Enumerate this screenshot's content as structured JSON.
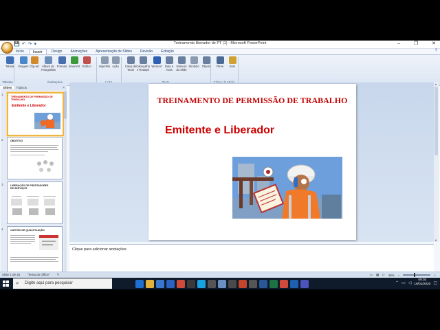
{
  "window": {
    "title": "Treinamento liberador de PT (1) - Microsoft PowerPoint",
    "controls": [
      "–",
      "❐",
      "✕"
    ],
    "quick_access": [
      "💾",
      "↶",
      "↷",
      "▾"
    ],
    "help": "?"
  },
  "ribbon": {
    "tabs": [
      "Início",
      "Inserir",
      "Design",
      "Animações",
      "Apresentação de Slides",
      "Revisão",
      "Exibição"
    ],
    "active_tab": "Inserir",
    "buttons": [
      {
        "label": "Tabela",
        "icon": "table-icon",
        "color": "#3f6fb6"
      },
      {
        "label": "Imagem",
        "icon": "picture-icon",
        "color": "#4a87c8"
      },
      {
        "label": "Clip-art",
        "icon": "clipart-icon",
        "color": "#d08a2a"
      },
      {
        "label": "Álbum de Fotografias",
        "icon": "album-icon",
        "color": "#6b8fb8"
      },
      {
        "label": "Formas",
        "icon": "shapes-icon",
        "color": "#4a6fb0"
      },
      {
        "label": "SmartArt",
        "icon": "smartart-icon",
        "color": "#3c9a3c"
      },
      {
        "label": "Gráfico",
        "icon": "chart-icon",
        "color": "#c0504d"
      },
      {
        "label": "Hiperlink",
        "icon": "hyperlink-icon",
        "color": "#8b9bb0"
      },
      {
        "label": "Ação",
        "icon": "action-icon",
        "color": "#8b9bb0"
      },
      {
        "label": "Caixa de Texto",
        "icon": "textbox-icon",
        "color": "#6a7f9f"
      },
      {
        "label": "Cabeçalho e Rodapé",
        "icon": "header-footer-icon",
        "color": "#6a7f9f"
      },
      {
        "label": "WordArt",
        "icon": "wordart-icon",
        "color": "#2e5fb0"
      },
      {
        "label": "Data e Hora",
        "icon": "datetime-icon",
        "color": "#6a7f9f"
      },
      {
        "label": "Número do Slide",
        "icon": "slide-number-icon",
        "color": "#6a7f9f"
      },
      {
        "label": "Símbolo",
        "icon": "symbol-icon",
        "color": "#8b9bb0"
      },
      {
        "label": "Objeto",
        "icon": "object-icon",
        "color": "#6a7f9f"
      },
      {
        "label": "Filme",
        "icon": "movie-icon",
        "color": "#4a6a96"
      },
      {
        "label": "Som",
        "icon": "sound-icon",
        "color": "#d0a030"
      }
    ],
    "groups": [
      "Tabelas",
      "Ilustrações",
      "Links",
      "Texto",
      "Clipes de Mídia"
    ]
  },
  "slide_panel": {
    "tabs": [
      "Slides",
      "Tópicos"
    ],
    "active_tab": "Slides",
    "thumbnails": [
      {
        "number": "1",
        "title": "TREINAMENTO DE PERMISSÃO DE TRABALHO",
        "subtitle": "Emitente e Liberador",
        "selected": true
      },
      {
        "number": "2",
        "title": "OBJETIVO",
        "selected": false
      },
      {
        "number": "3",
        "title": "LIBERAÇÃO DE PRESTADORES DE SERVIÇOS",
        "selected": false
      },
      {
        "number": "4",
        "title": "CARTÃO DE QUALIFICAÇÃO",
        "selected": false
      }
    ]
  },
  "slide": {
    "title": "TREINAMENTO DE PERMISSÃO DE TRABALHO",
    "subtitle": "Emitente e Liberador"
  },
  "notes": {
    "placeholder": "Clique para adicionar anotações"
  },
  "status": {
    "slide_info": "Slide 1 de 25",
    "theme": "\"Tema do Office\"",
    "zoom": "48%"
  },
  "taskbar": {
    "search_placeholder": "Digite aqui para pesquisar",
    "time": "09:03",
    "date": "19/01/2020",
    "apps": [
      {
        "icon": "cortana-icon",
        "color": "#0f1a2a"
      },
      {
        "icon": "task-view-icon",
        "color": "#0f1a2a"
      },
      {
        "icon": "edge-icon",
        "color": "#1e6fd0"
      },
      {
        "icon": "file-explorer-icon",
        "color": "#e0b23a"
      },
      {
        "icon": "store-icon",
        "color": "#3a78d0"
      },
      {
        "icon": "mail-icon",
        "color": "#2a63c2"
      },
      {
        "icon": "chrome-icon",
        "color": "#d04a3a"
      },
      {
        "icon": "media-icon",
        "color": "#3a3a3a"
      },
      {
        "icon": "skype-icon",
        "color": "#1aa2e0"
      },
      {
        "icon": "calc-icon",
        "color": "#555"
      },
      {
        "icon": "gallery-icon",
        "color": "#6b8fc0"
      },
      {
        "icon": "app-icon",
        "color": "#4a4a4a"
      },
      {
        "icon": "powerpoint-icon",
        "color": "#c4452c"
      },
      {
        "icon": "settings-icon",
        "color": "#555"
      },
      {
        "icon": "word-icon",
        "color": "#2b5797"
      },
      {
        "icon": "excel-icon",
        "color": "#1e7145"
      },
      {
        "icon": "chrome-icon",
        "color": "#d04a3a"
      },
      {
        "icon": "outlook-icon",
        "color": "#1f5fb0"
      },
      {
        "icon": "teams-icon",
        "color": "#4b53bc"
      }
    ]
  }
}
